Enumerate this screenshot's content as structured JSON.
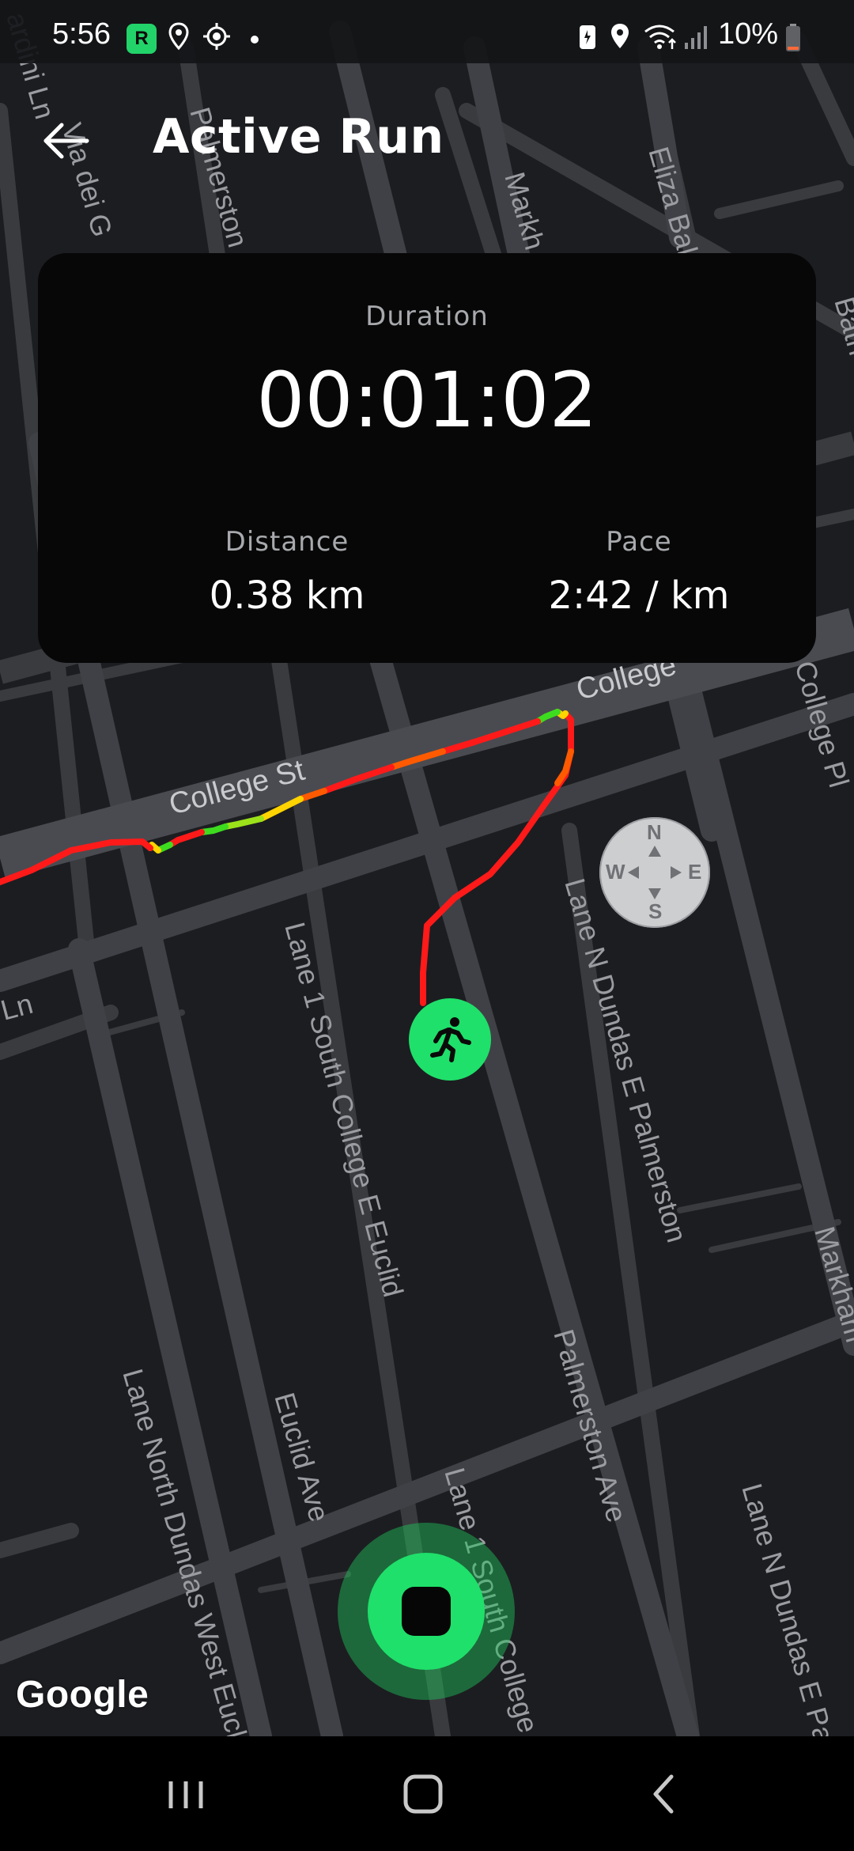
{
  "status_bar": {
    "time": "5:56",
    "app_badge": "R",
    "battery": "10%",
    "icons": [
      "location-pin-icon",
      "gps-target-icon",
      "dot-icon",
      "battery-saver-icon",
      "location-pin-icon",
      "wifi-icon",
      "signal-icon",
      "battery-icon"
    ]
  },
  "header": {
    "title": "Active Run",
    "back_icon": "arrow-left-icon"
  },
  "stats": {
    "duration_label": "Duration",
    "duration_value": "00:01:02",
    "distance_label": "Distance",
    "distance_value": "0.38 km",
    "pace_label": "Pace",
    "pace_value": "2:42 / km"
  },
  "map": {
    "streets": {
      "college_st": "College St",
      "college_st_top": "College",
      "college_pl": "College Pl",
      "lane1_south_college_e_euclid": "Lane 1 South College E Euclid",
      "lane_n_dundas_e_palmerston": "Lane N Dundas E Palmerston",
      "lane_n_dundas_e_pal": "Lane N Dundas E Pal",
      "palmerston_ave": "Palmerston Ave",
      "euclid_ave": "Euclid Ave",
      "lane_north_dundas_west_eucli": "Lane North Dundas West Eucli",
      "lane1_south_college": "Lane 1 South College",
      "markham": "Markham",
      "markh": "Markh",
      "eliza_bal": "Eliza Bal",
      "palmerston_top": "Palmerston",
      "via_dei_g": "Via dei G",
      "ardini_ln": "ardini Ln",
      "bath": "Bath",
      "ln_left": "Ln"
    },
    "compass": {
      "n": "N",
      "s": "S",
      "e": "E",
      "w": "W"
    },
    "attribution": "Google",
    "route_colors": {
      "fast": "#ff1a1a",
      "mid": "#ff6a00",
      "slow": "#ffd400",
      "green": "#3ddc1f"
    }
  },
  "controls": {
    "stop_icon": "stop-icon",
    "runner_icon": "runner-icon"
  },
  "nav_bar": {
    "recents_icon": "recents-icon",
    "home_icon": "home-icon",
    "back_icon": "back-chevron-icon"
  }
}
